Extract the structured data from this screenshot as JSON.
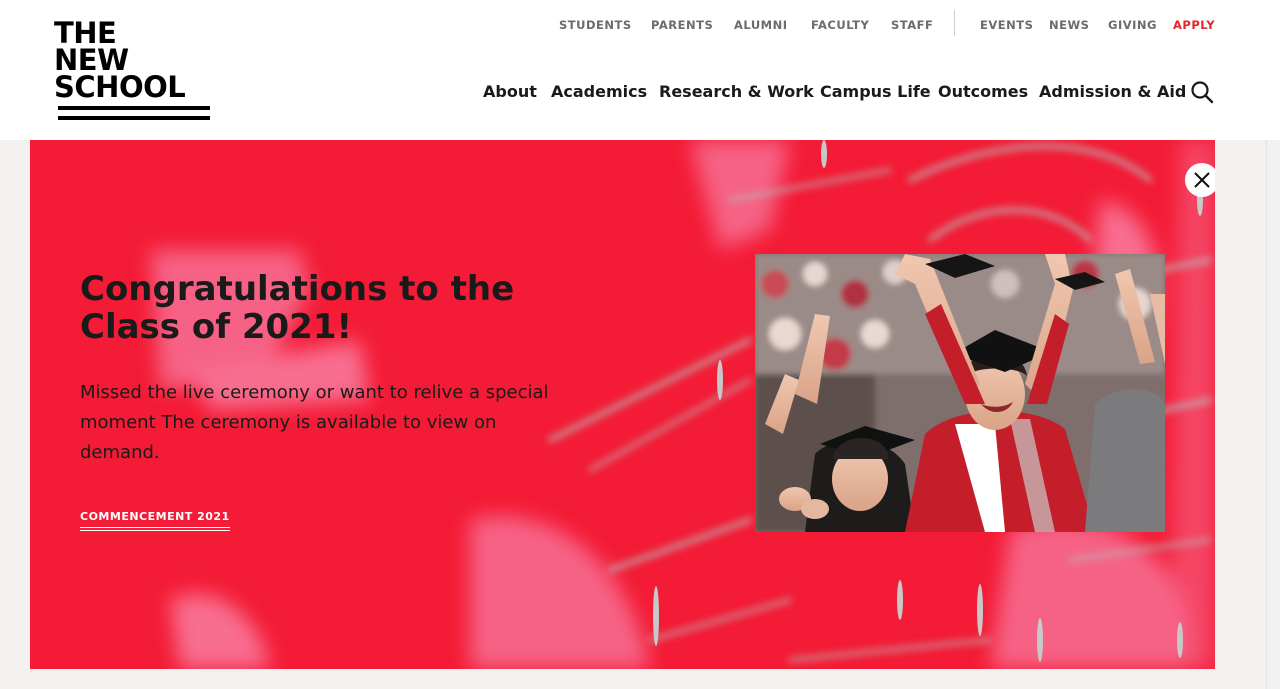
{
  "logo": {
    "lines": [
      "THE",
      "NEW",
      "SCHOOL"
    ]
  },
  "utility_nav": {
    "items": [
      {
        "label": "STUDENTS"
      },
      {
        "label": "PARENTS"
      },
      {
        "label": "ALUMNI"
      },
      {
        "label": "FACULTY"
      },
      {
        "label": "STAFF"
      },
      {
        "label": "EVENTS"
      },
      {
        "label": "NEWS"
      },
      {
        "label": "GIVING"
      },
      {
        "label": "APPLY"
      }
    ]
  },
  "main_nav": {
    "items": [
      {
        "label": "About"
      },
      {
        "label": "Academics"
      },
      {
        "label": "Research & Work"
      },
      {
        "label": "Campus Life"
      },
      {
        "label": "Outcomes"
      },
      {
        "label": "Admission & Aid"
      }
    ]
  },
  "banner": {
    "headline": "Congratulations to the Class of 2021!",
    "body": "Missed the live ceremony or want to relive a special moment The ceremony is available to view on demand.",
    "cta_label": "COMMENCEMENT 2021"
  },
  "colors": {
    "banner_bg": "#f31b35",
    "apply_accent": "#e3252e",
    "utility_text": "#6b6b6b"
  },
  "icons": {
    "search": "search-icon",
    "close": "close-icon"
  }
}
